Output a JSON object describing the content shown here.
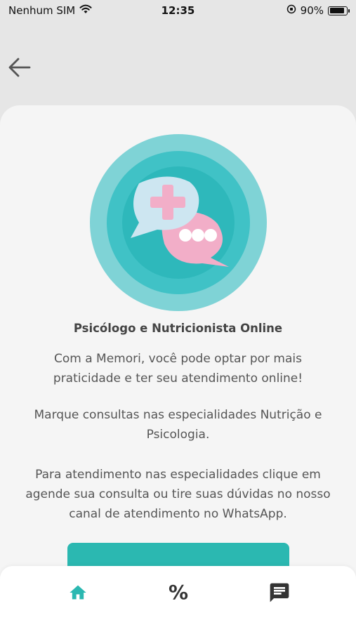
{
  "status_bar": {
    "carrier": "Nenhum SIM",
    "time": "12:35",
    "battery_percent": "90%",
    "battery_level": 0.9
  },
  "nav": {
    "back_icon": "arrow-left-icon"
  },
  "content": {
    "title": "Psicólogo e Nutricionista Online",
    "paragraph1": "Com a Memori, você pode optar por mais praticidade e ter seu atendimento online!",
    "paragraph2": "Marque consultas nas especialidades Nutrição e Psicologia.",
    "paragraph3": "Para atendimento nas especialidades clique em agende sua consulta ou tire suas dúvidas no nosso canal de atendimento no WhatsApp."
  },
  "bottom_nav": {
    "items": [
      {
        "icon": "home-icon",
        "active": true
      },
      {
        "icon": "percent-icon",
        "active": false
      },
      {
        "icon": "chat-icon",
        "active": false
      }
    ]
  },
  "colors": {
    "accent": "#2bb8b1",
    "background": "#e6e6e6",
    "card": "#f5f5f5",
    "bubble_blue": "#cde6f1",
    "bubble_pink": "#f2aec8"
  }
}
